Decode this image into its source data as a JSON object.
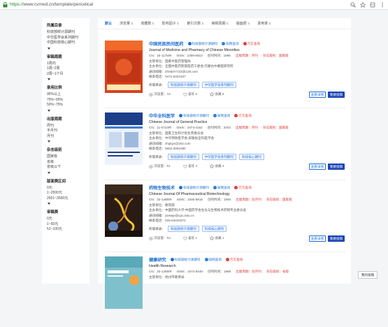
{
  "browser": {
    "url_prefix": "https://",
    "url_rest": "www.cvmed.cn/template/periodical"
  },
  "filters": [
    {
      "title": "所属目录",
      "items": [
        "科技部统计源期刊",
        "中华医学会系列期刊",
        "中国科技核心期刊"
      ]
    },
    {
      "title": "审稿周期",
      "items": [
        "1周内",
        "1周~2周",
        "2周~1个月"
      ]
    },
    {
      "title": "录用比例",
      "items": [
        "95%以上",
        "75%~95%",
        "50%~75%"
      ]
    },
    {
      "title": "出版周期",
      "items": [
        "周刊",
        "半月刊",
        "月刊"
      ]
    },
    {
      "title": "杂志级别",
      "items": [
        "国家级",
        "省级",
        "省级以下"
      ]
    },
    {
      "title": "版面费区间",
      "items": [
        "0元",
        "1~2500元",
        "2501~3500元"
      ]
    },
    {
      "title": "审稿费",
      "items": [
        "0元",
        "1~50元",
        "51~100元"
      ]
    }
  ],
  "tabs": [
    "默认",
    "浏览量",
    "收藏数",
    "影响因子",
    "被引次数",
    "审稿周期",
    "版面费",
    "录用率"
  ],
  "journals": [
    {
      "title_cn": "中国民族民间医药",
      "badge1": "科技部统计源期刊",
      "badge2": "知网查询",
      "badge3": "万方查询",
      "title_en": "Journal of Medicine and Pharmacy of Chinese Minorities",
      "cn": "CN：15-1175/R",
      "issn": "ISSN：1006-6810",
      "year": "创刊时间：1995",
      "freq": "出版周期：月刊",
      "level": "杂志级别：国家级",
      "sponsor": "主管单位：国家中医药管理局",
      "organizer": "主办单位：全国中医药民族医药工委会;内蒙古中蒙医研究所",
      "email": "通讯邮箱：ZGMZYYZZ@126.com",
      "phone": "联系电话：0471-6323167",
      "catalog_label": "所属目录：",
      "tags": [
        "科技部统计源期刊",
        "中华医学会系列期刊"
      ],
      "views": "浏览量：18",
      "likes": "喜欢 6",
      "favs": "收藏 8",
      "cover_title": "中国民族民间医药",
      "cover_bg": "#d9411d",
      "cover_accent": "#ffe9b0"
    },
    {
      "title_cn": "中华全科医学",
      "badge1": "科技部统计源期刊",
      "badge2": "知网查询",
      "badge3": "万方查询",
      "title_en": "Chinese Journal of General Practice",
      "cn": "CN：11-5710/R",
      "issn": "ISSN：1674-4152",
      "year": "创刊时间：2003",
      "freq": "出版周期：月刊",
      "level": "杂志级别：国家级",
      "sponsor": "主管单位：国家卫生和计划生育委员会",
      "organizer": "主办单位：中华预防医学会;安徽省全科医学会",
      "email": "通讯邮箱：zhqkyx@163.com",
      "phone": "联系电话：0552-3051080",
      "catalog_label": "所属目录：",
      "tags": [
        "科技部统计源期刊",
        "中华医学会系列期刊",
        "科技核心期刊"
      ],
      "views": "浏览量：81",
      "likes": "喜欢 4",
      "favs": "收藏 4",
      "cover_title": "中华全科医学",
      "cover_bg": "#1d3f8a",
      "cover_accent": "#cfe3ff"
    },
    {
      "title_cn": "药物生物技术",
      "badge1": "科技部统计源期刊",
      "badge2": "知网查询",
      "badge3": "万方查询",
      "title_en": "Chinese Journal Of Pharmaceutical Biotechnology",
      "cn": "CN：32-1488/R",
      "issn": "ISSN：1005-8915",
      "year": "创刊时间：1994",
      "freq": "出版周期：双月刊",
      "level": "杂志级别：国家级",
      "sponsor": "主管单位：教育部",
      "organizer": "主办单位：中国药科大学;中国药学会生化与生物技术药物专业委员会",
      "email": "通讯邮箱：ywswjs@cpu.edu.cn",
      "phone": "联系电话：025-83220372",
      "catalog_label": "所属目录：",
      "tags": [
        "科技部统计源期刊",
        "科技核心期刊"
      ],
      "views": "浏览量：53",
      "likes": "喜欢 1",
      "favs": "收藏 1",
      "cover_title": "药物生物技术",
      "cover_bg": "#2a1c14",
      "cover_accent": "#f0c232"
    },
    {
      "title_cn": "健康研究",
      "badge1": "科技部统计源期刊",
      "badge2": "知网查询",
      "badge3": "万方查询",
      "title_en": "Health Research",
      "cn": "CN：33-1359/R",
      "issn": "ISSN：1674-6449",
      "year": "创刊时间：1980",
      "freq": "出版周期：双月刊",
      "level": "杂志级别：省级",
      "sponsor": "主管单位：杭州市教育局",
      "cover_title": "健康研究",
      "cover_bg": "#7ec0cc",
      "cover_accent": "#ffffff"
    }
  ],
  "buttons": {
    "detail": "查看详情",
    "submit": "我要投稿"
  },
  "help": "我的投稿"
}
